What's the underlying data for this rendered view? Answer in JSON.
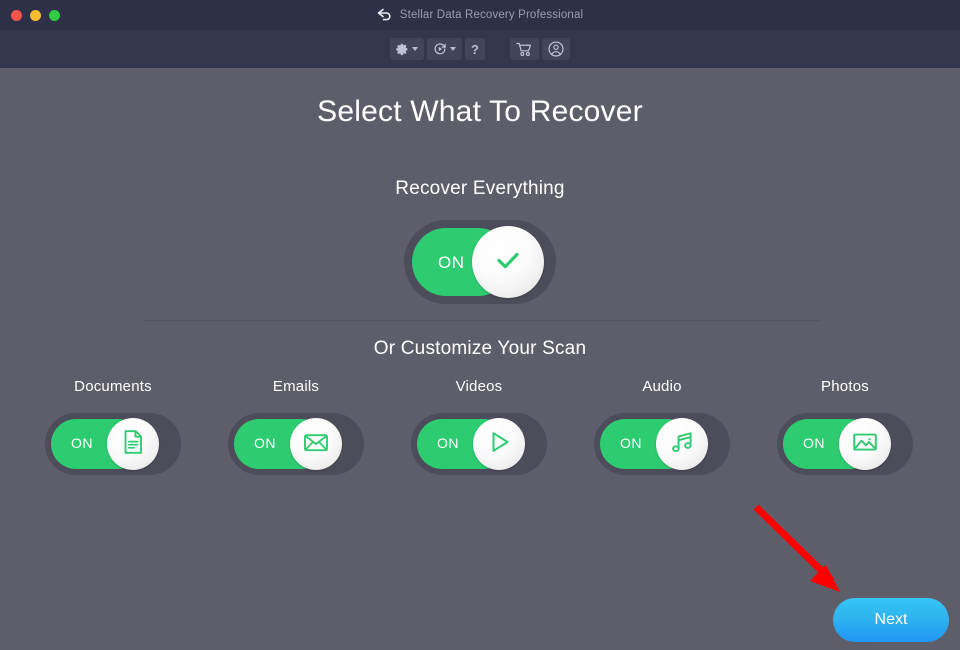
{
  "window": {
    "title": "Stellar Data Recovery Professional",
    "back_icon": "back-arrow-icon",
    "controls": [
      {
        "name": "close",
        "color": "#f4564c"
      },
      {
        "name": "minimize",
        "color": "#f7bd2e"
      },
      {
        "name": "maximize",
        "color": "#2ecc40"
      }
    ]
  },
  "toolbar": {
    "settings": {
      "icon": "gear-icon",
      "has_caret": true
    },
    "resume": {
      "icon": "resume-scan-icon",
      "has_caret": true
    },
    "help": {
      "label": "?",
      "icon": "help-icon"
    },
    "cart": {
      "icon": "shopping-cart-icon"
    },
    "account": {
      "icon": "user-account-icon"
    }
  },
  "main": {
    "page_title": "Select What To Recover",
    "everything_title": "Recover Everything",
    "customize_title": "Or Customize Your Scan",
    "master_toggle": {
      "label": "ON",
      "state": "on",
      "icon": "checkmark-icon"
    },
    "categories": [
      {
        "label": "Documents",
        "toggle_label": "ON",
        "state": "on",
        "icon": "document-icon"
      },
      {
        "label": "Emails",
        "toggle_label": "ON",
        "state": "on",
        "icon": "envelope-icon"
      },
      {
        "label": "Videos",
        "toggle_label": "ON",
        "state": "on",
        "icon": "play-icon"
      },
      {
        "label": "Audio",
        "toggle_label": "ON",
        "state": "on",
        "icon": "music-note-icon"
      },
      {
        "label": "Photos",
        "toggle_label": "ON",
        "state": "on",
        "icon": "image-icon"
      }
    ],
    "next_button": "Next"
  },
  "annotation": {
    "arrow": "red-pointer-arrow",
    "color": "#ff0000"
  },
  "colors": {
    "titlebar": "#2e3047",
    "toolbar": "#34364e",
    "content_bg": "#5e5e6b",
    "toggle_track": "#4c4c5a",
    "accent_green": "#2ecc71",
    "next_blue": "#2196f3",
    "title_text": "#9a9db5"
  }
}
